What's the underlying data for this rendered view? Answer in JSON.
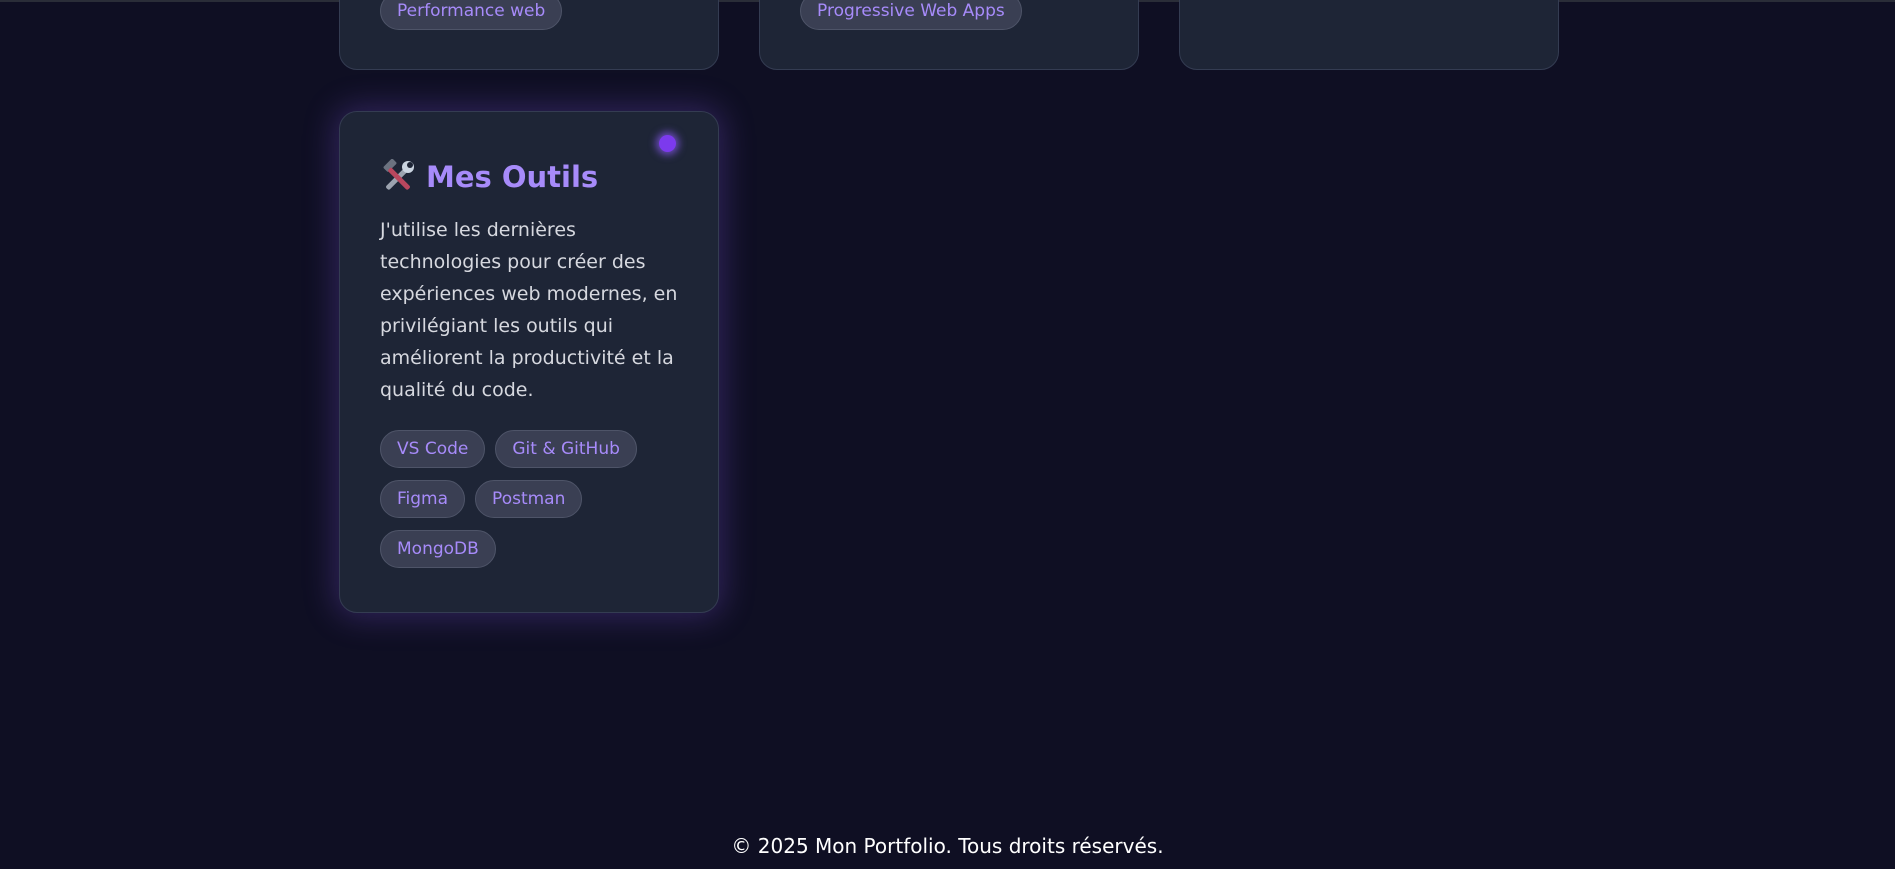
{
  "top_cards": [
    {
      "tag": "Performance web"
    },
    {
      "tag": "Progressive Web Apps"
    },
    {
      "tag": null
    }
  ],
  "tools_card": {
    "icon": "hammer-and-wrench-icon",
    "title": "Mes Outils",
    "description": "J'utilise les dernières technologies pour créer des expériences web modernes, en privilégiant les outils qui améliorent la productivité et la qualité du code.",
    "tags": [
      "VS Code",
      "Git & GitHub",
      "Figma",
      "Postman",
      "MongoDB"
    ]
  },
  "footer": {
    "text": "© 2025 Mon Portfolio. Tous droits réservés."
  },
  "colors": {
    "background": "#0f0f23",
    "card": "#1e2536",
    "accent": "#a78bfa",
    "glow": "#7c3aed"
  }
}
